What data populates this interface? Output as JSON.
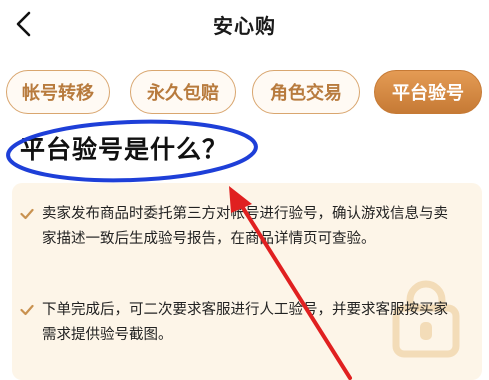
{
  "header": {
    "title": "安心购"
  },
  "tabs": [
    {
      "label": "帐号转移",
      "active": false
    },
    {
      "label": "永久包赔",
      "active": false
    },
    {
      "label": "角色交易",
      "active": false
    },
    {
      "label": "平台验号",
      "active": true
    }
  ],
  "content": {
    "heading": "平台验号是什么？",
    "items": [
      {
        "text": "卖家发布商品时委托第三方对帐号进行验号，确认游戏信息与卖家描述一致后生成验号报告，在商品详情页可查验。"
      },
      {
        "text": "下单完成后，可二次要求客服进行人工验号，并要求客服按买家需求提供验号截图。"
      }
    ]
  },
  "colors": {
    "accent": "#c67a35",
    "tab_border": "#d9a66f",
    "card_background": "#fdf5e8",
    "annotation_ellipse": "#1e3fd8",
    "annotation_arrow": "#e02020"
  },
  "icons": {
    "back": "chevron-left-icon",
    "check": "check-icon",
    "watermark": "lock-shield-icon"
  }
}
